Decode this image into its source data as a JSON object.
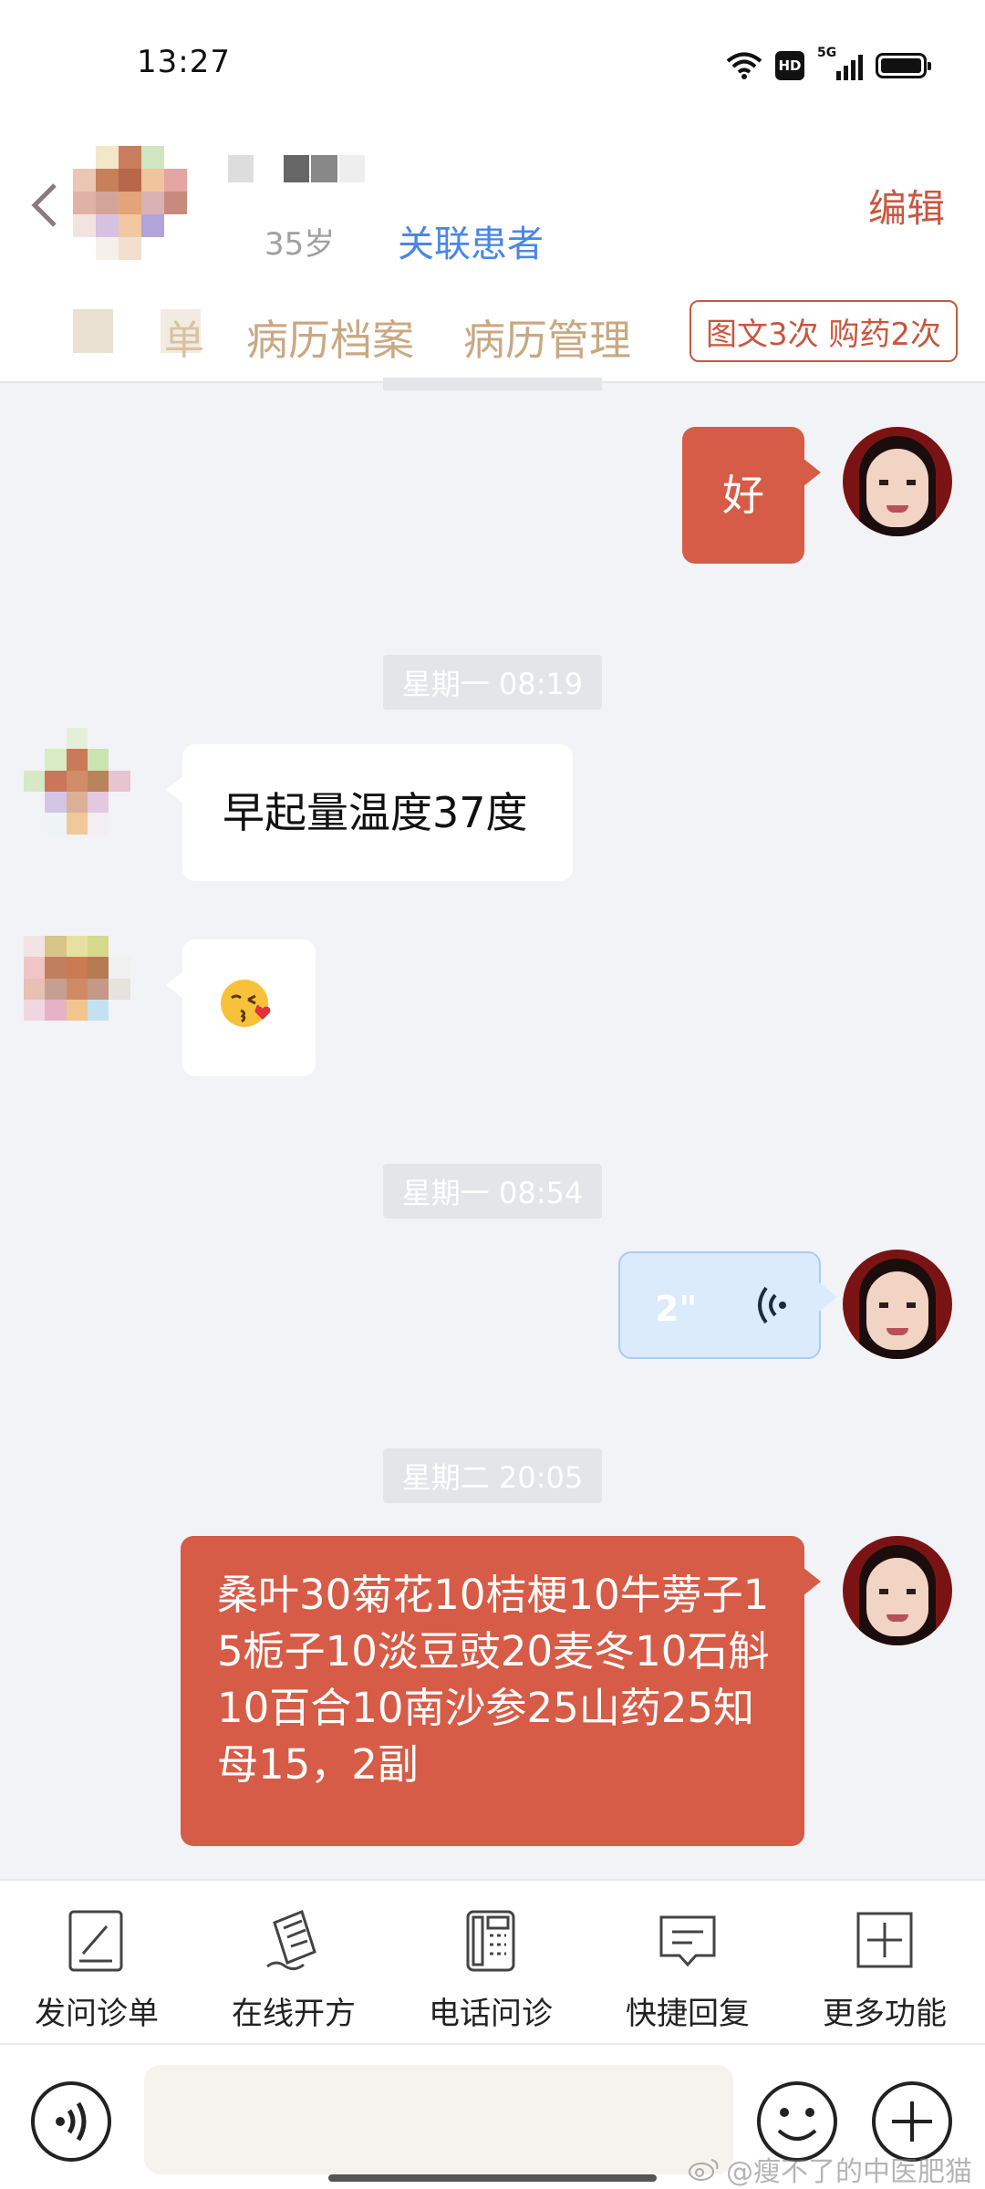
{
  "status_bar": {
    "time": "13:27",
    "hd_label": "HD",
    "network_label": "5G"
  },
  "header": {
    "age": "35岁",
    "link_patient": "关联患者",
    "edit": "编辑",
    "tab_partial": "单",
    "tabs": [
      "病历档案",
      "病历管理"
    ],
    "service_badge": "图文3次 购药2次"
  },
  "messages": {
    "reply_ok": "好",
    "ts1": "星期一 08:19",
    "patient_temp": "早起量温度37度",
    "ts2": "星期一 08:54",
    "voice_duration": "2\"",
    "ts3": "星期二 20:05",
    "prescription": "桑叶30菊花10桔梗10牛蒡子15栀子10淡豆豉20麦冬10石斛10百合10南沙参25山药25知母15，2副"
  },
  "toolbar": {
    "items": [
      "发问诊单",
      "在线开方",
      "电话问诊",
      "快捷回复",
      "更多功能"
    ]
  },
  "input": {
    "placeholder": ""
  },
  "watermark": "@瘦不了的中医肥猫",
  "colors": {
    "accent": "#d65c47",
    "link": "#4a86e8",
    "tab": "#c9a882",
    "chat_bg": "#f2f3f7",
    "voice_bubble": "#dcebfb"
  }
}
